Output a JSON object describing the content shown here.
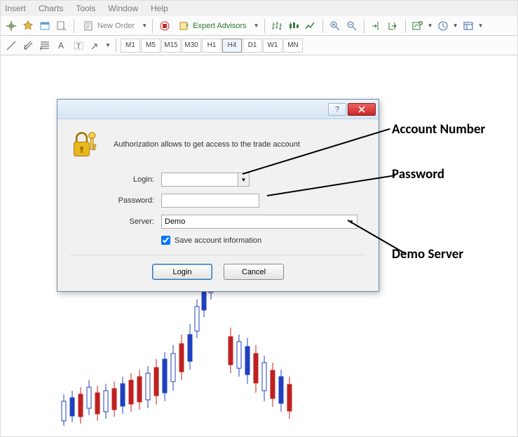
{
  "menu": {
    "items": [
      "Insert",
      "Charts",
      "Tools",
      "Window",
      "Help"
    ]
  },
  "toolbar1": {
    "new_order": "New Order",
    "expert_advisors": "Expert Advisors"
  },
  "timeframes": [
    "M1",
    "M5",
    "M15",
    "M30",
    "H1",
    "H4",
    "D1",
    "W1",
    "MN"
  ],
  "timeframe_selected": "H4",
  "dialog": {
    "auth_text": "Authorization allows to get access to the trade account",
    "login_label": "Login:",
    "password_label": "Password:",
    "server_label": "Server:",
    "server_value": "Demo",
    "save_label": "Save account information",
    "login_btn": "Login",
    "cancel_btn": "Cancel",
    "help_glyph": "?"
  },
  "annotations": {
    "account_number": "Account Number",
    "password": "Password",
    "demo_server": "Demo Server"
  }
}
